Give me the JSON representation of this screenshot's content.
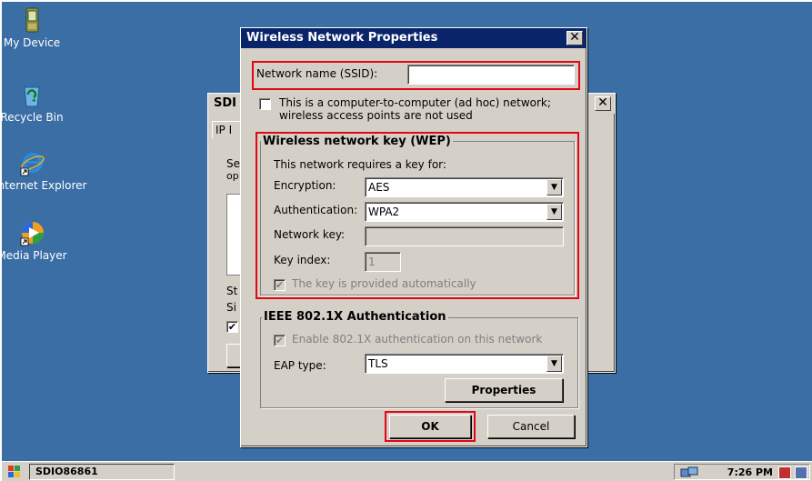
{
  "desktop": {
    "icons": [
      {
        "label": "My Device",
        "icon": "pda-icon"
      },
      {
        "label": "Recycle Bin",
        "icon": "recycle-bin-icon"
      },
      {
        "label": "Internet Explorer",
        "icon": "internet-explorer-icon"
      },
      {
        "label": "Media Player",
        "icon": "media-player-icon"
      }
    ]
  },
  "bg_window": {
    "title": "SDI",
    "tab": "IP I",
    "text1": "Se",
    "text2": "op",
    "text3": "St",
    "text4": "Si"
  },
  "dialog": {
    "title": "Wireless Network Properties",
    "ssid_label": "Network name (SSID):",
    "ssid_value": "",
    "adhoc_line1": "This is a computer-to-computer (ad hoc) network;",
    "adhoc_line2": "wireless access points are not used",
    "adhoc_checked": false,
    "wep_group_title": "Wireless network key (WEP)",
    "requires_key_label": "This network requires a key for:",
    "encryption_label": "Encryption:",
    "encryption_value": "AES",
    "authentication_label": "Authentication:",
    "authentication_value": "WPA2",
    "network_key_label": "Network key:",
    "network_key_value": "",
    "key_index_label": "Key index:",
    "key_index_value": "1",
    "auto_key_label": "The key is provided automatically",
    "auto_key_checked": true,
    "ieee_group_title": "IEEE 802.1X Authentication",
    "enable_8021x_label": "Enable 802.1X authentication on this network",
    "enable_8021x_checked": true,
    "eap_label": "EAP type:",
    "eap_value": "TLS",
    "properties_button": "Properties",
    "ok_button": "OK",
    "cancel_button": "Cancel"
  },
  "taskbar": {
    "task_label": "SDIO86861",
    "clock": "7:26 PM"
  },
  "colors": {
    "desktop": "#3a6ea5",
    "titlebar": "#0a246a",
    "highlight": "#e30613",
    "face": "#d4d0c8"
  }
}
